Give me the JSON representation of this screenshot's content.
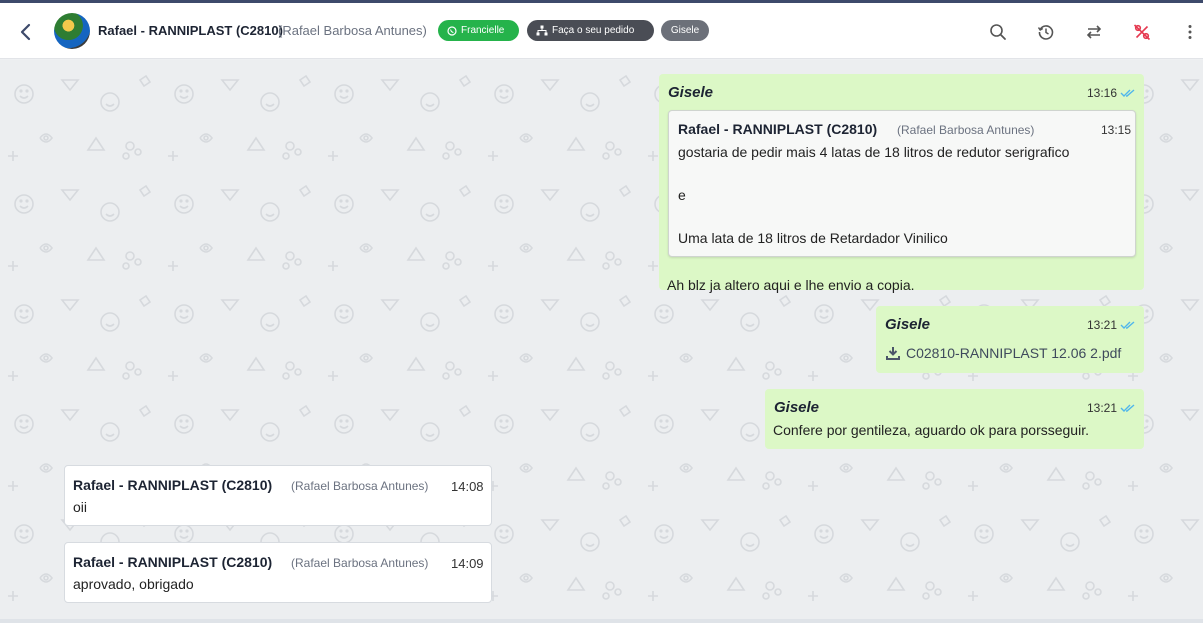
{
  "header": {
    "contact_name": "Rafael - RANNIPLAST (C2810)",
    "contact_subtitle": "(Rafael Barbosa Antunes)",
    "tags": [
      {
        "label": "Francielle",
        "color": "#25b34b",
        "icon": "whatsapp-icon"
      },
      {
        "label": "Faça o seu pedido",
        "color": "#4a4d55",
        "icon": "sitemap-icon"
      },
      {
        "label": "Gisele",
        "color": "#6c7079"
      }
    ],
    "icons": [
      "search-icon",
      "history-icon",
      "transfer-icon",
      "percent-off-icon",
      "more-vert-icon"
    ],
    "accent_red": "#e53950"
  },
  "messages": [
    {
      "sender": "Gisele",
      "time": "13:16",
      "quote": {
        "name": "Rafael - RANNIPLAST (C2810)",
        "subtitle": "(Rafael Barbosa Antunes)",
        "time": "13:15",
        "lines": [
          "gostaria de pedir mais 4 latas de 18 litros de redutor serigrafico",
          "e",
          "Uma lata de 18 litros de Retardador Vinilico"
        ]
      },
      "text": "Ah blz ja altero aqui e lhe envio a copia."
    },
    {
      "sender": "Gisele",
      "time": "13:21",
      "attachment": "C02810-RANNIPLAST 12.06 2.pdf"
    },
    {
      "sender": "Gisele",
      "time": "13:21",
      "text": "Confere por gentileza, aguardo ok para porsseguir."
    },
    {
      "name": "Rafael - RANNIPLAST (C2810)",
      "subtitle": "(Rafael Barbosa Antunes)",
      "time": "14:08",
      "text": "oii"
    },
    {
      "name": "Rafael - RANNIPLAST (C2810)",
      "subtitle": "(Rafael Barbosa Antunes)",
      "time": "14:09",
      "text": "aprovado, obrigado"
    }
  ],
  "colors": {
    "bubble_out": "#dcf8c6",
    "bubble_in": "#ffffff",
    "read_ticks": "#4fb6ec"
  }
}
